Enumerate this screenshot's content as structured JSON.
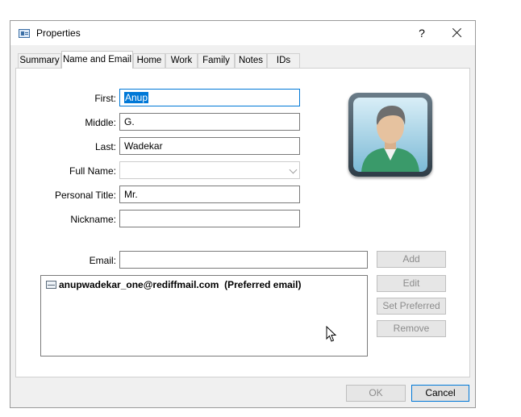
{
  "window": {
    "title": "Properties",
    "help_glyph": "?"
  },
  "tabs": [
    {
      "label": "Summary",
      "active": false
    },
    {
      "label": "Name and Email",
      "active": true
    },
    {
      "label": "Home",
      "active": false
    },
    {
      "label": "Work",
      "active": false
    },
    {
      "label": "Family",
      "active": false
    },
    {
      "label": "Notes",
      "active": false
    },
    {
      "label": "IDs",
      "active": false
    }
  ],
  "form": {
    "first_label": "First:",
    "first_value": "Anup",
    "middle_label": "Middle:",
    "middle_value": "G.",
    "last_label": "Last:",
    "last_value": "Wadekar",
    "fullname_label": "Full Name:",
    "fullname_value": "",
    "title_label": "Personal Title:",
    "title_value": "Mr.",
    "nickname_label": "Nickname:",
    "nickname_value": "",
    "email_label": "Email:",
    "email_value": ""
  },
  "email_list": [
    {
      "address": "anupwadekar_one@rediffmail.com",
      "note": "(Preferred email)"
    }
  ],
  "email_buttons": {
    "add": "Add",
    "edit": "Edit",
    "set_preferred": "Set Preferred",
    "remove": "Remove"
  },
  "footer": {
    "ok": "OK",
    "cancel": "Cancel"
  },
  "colors": {
    "accent": "#0078d7",
    "window_bg": "#f0f0f0"
  }
}
